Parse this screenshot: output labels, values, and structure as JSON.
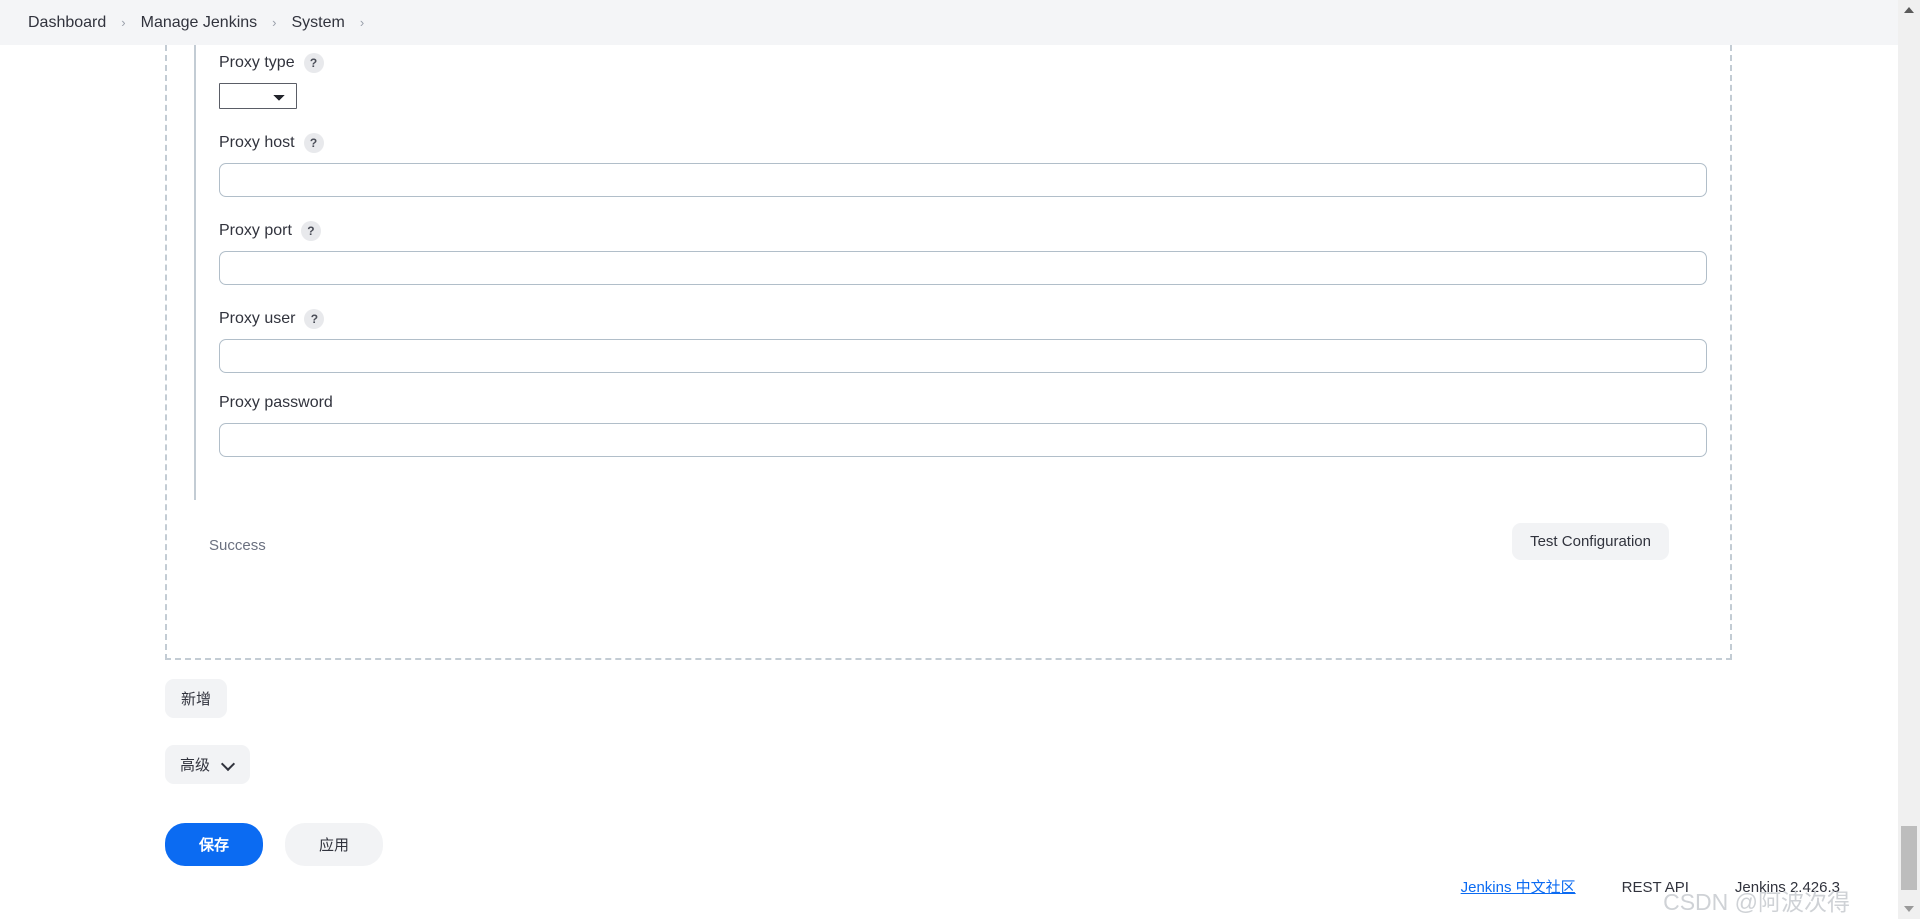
{
  "breadcrumb": {
    "items": [
      {
        "label": "Dashboard"
      },
      {
        "label": "Manage Jenkins"
      },
      {
        "label": "System"
      }
    ],
    "separator": "›"
  },
  "form": {
    "help_glyph": "?",
    "fields": [
      {
        "label": "Proxy type",
        "type": "select",
        "value": "",
        "has_help": true
      },
      {
        "label": "Proxy host",
        "type": "text",
        "value": "",
        "has_help": true
      },
      {
        "label": "Proxy port",
        "type": "text",
        "value": "",
        "has_help": true
      },
      {
        "label": "Proxy user",
        "type": "text",
        "value": "",
        "has_help": true
      },
      {
        "label": "Proxy password",
        "type": "password",
        "value": "",
        "has_help": false
      }
    ],
    "validation": {
      "status_text": "Success",
      "test_button_label": "Test Configuration"
    }
  },
  "actions": {
    "add_label": "新增",
    "advanced_label": "高级",
    "save_label": "保存",
    "apply_label": "应用"
  },
  "footer": {
    "community_link": "Jenkins 中文社区",
    "rest_api": "REST API",
    "version": "Jenkins 2.426.3",
    "watermark": "CSDN @阿波次得"
  },
  "colors": {
    "primary": "#0b6bf2",
    "dashed_border": "#c3ccd4",
    "input_border": "#b1bec9",
    "header_bg": "#f4f5f7"
  }
}
